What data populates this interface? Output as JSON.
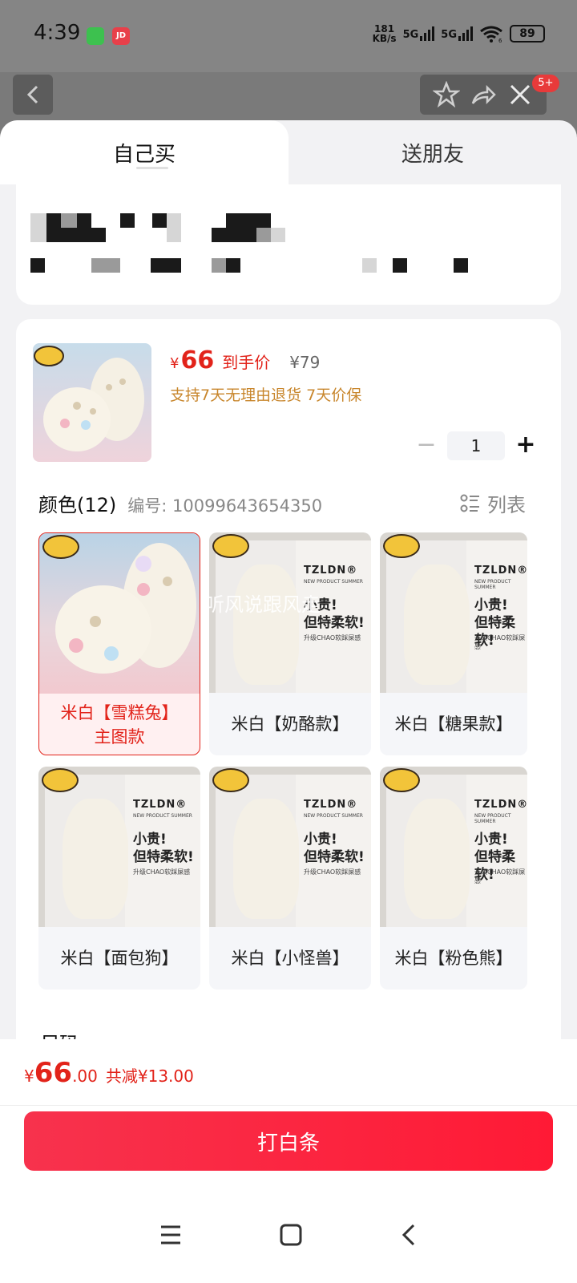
{
  "status_bar": {
    "time": "4:39",
    "jd_app": "JD",
    "net_speed": "181",
    "net_unit": "KB/s",
    "sim1": "5G",
    "sim2": "5G",
    "wifi_sub": "6",
    "battery": "89"
  },
  "nav": {
    "badge": "5+"
  },
  "tabs": {
    "self": "自己买",
    "friend": "送朋友"
  },
  "product": {
    "price_symbol": "¥",
    "price": "66",
    "price_tag": "到手价",
    "original_price": "¥79",
    "services": "支持7天无理由退货 7天价保",
    "quantity": "1",
    "minus": "−",
    "plus": "+"
  },
  "color_section": {
    "title": "颜色(12)",
    "sku": "编号: 10099643654350",
    "list_label": "列表"
  },
  "promo_art": {
    "brand": "TZLDN®",
    "brand_sub": "NEW PRODUCT SUMMER",
    "slogan_line1": "小贵!",
    "slogan_line2": "但特柔软!",
    "small_text": "升级CHAO软踩屎感"
  },
  "options": [
    {
      "label_line1": "米白【雪糕兔】",
      "label_line2": "主图款",
      "selected": true
    },
    {
      "label_line1": "米白【奶酪款】",
      "label_line2": ""
    },
    {
      "label_line1": "米白【糖果款】",
      "label_line2": ""
    },
    {
      "label_line1": "米白【面包狗】",
      "label_line2": ""
    },
    {
      "label_line1": "米白【小怪兽】",
      "label_line2": ""
    },
    {
      "label_line1": "米白【粉色熊】",
      "label_line2": ""
    }
  ],
  "watermark": "听风说跟风走",
  "size_peek": "尺码",
  "footer": {
    "symbol": "¥",
    "price_int": "66",
    "price_dec": ".00",
    "savings": "共减¥13.00",
    "buy_label": "打白条"
  },
  "colors": {
    "accent": "#e2231a",
    "service": "#c8862c",
    "button": "#ff1a35"
  }
}
